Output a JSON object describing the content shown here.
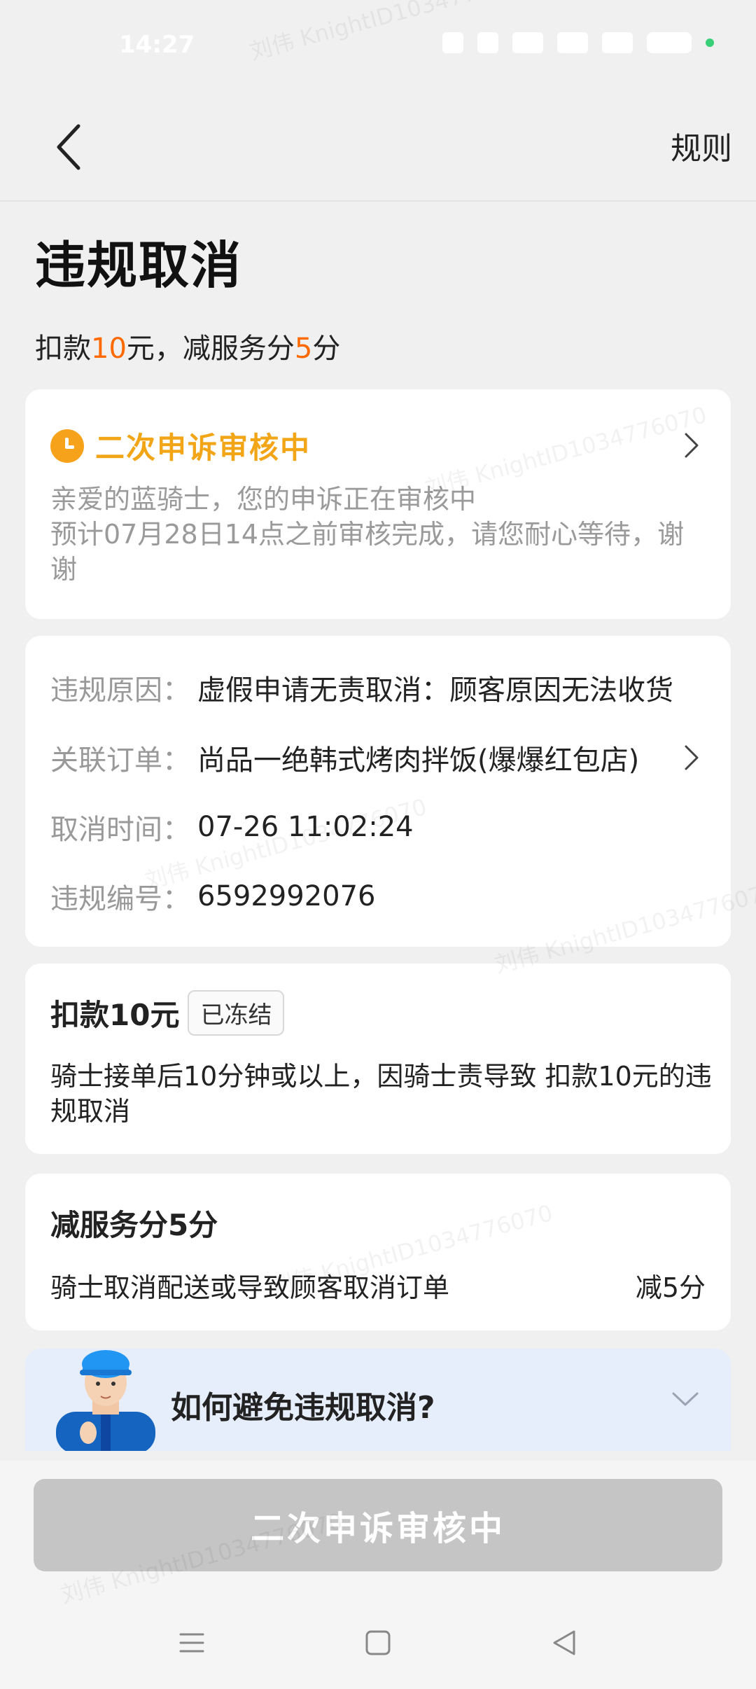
{
  "status_bar": {
    "time": "14:27",
    "icons": [
      "bluetooth-icon",
      "location-icon",
      "wifi-icon",
      "signal-5g-icon",
      "signal-5g-icon",
      "battery-icon"
    ]
  },
  "nav": {
    "back_icon": "chevron-left-icon",
    "rules_label": "规则"
  },
  "header": {
    "title": "违规取消",
    "penalty_prefix": "扣款",
    "penalty_amount": "10",
    "penalty_unit": "元，减服务分",
    "penalty_score": "5",
    "penalty_suffix": "分"
  },
  "status_card": {
    "title": "二次申诉审核中",
    "line1": "亲爱的蓝骑士，您的申诉正在审核中",
    "line2": "预计07月28日14点之前审核完成，请您耐心等待，谢谢",
    "accent_color": "#f2a516"
  },
  "info_card": {
    "rows": [
      {
        "label": "违规原因：",
        "value": "虚假申请无责取消：顾客原因无法收货"
      },
      {
        "label": "关联订单：",
        "value": "尚品一绝韩式烤肉拌饭(爆爆红包店)"
      },
      {
        "label": "取消时间：",
        "value": "07-26 11:02:24"
      },
      {
        "label": "违规编号：",
        "value": "6592992076"
      }
    ]
  },
  "deduct_card": {
    "title": "扣款10元",
    "badge": "已冻结",
    "desc": "骑士接单后10分钟或以上，因骑士责导致 扣款10元的违规取消"
  },
  "score_card": {
    "title": "减服务分5分",
    "rule": "骑士取消配送或导致顾客取消订单",
    "value": "减5分"
  },
  "tips": {
    "text": "如何避免违规取消?"
  },
  "bottom": {
    "button_label": "二次申诉审核中"
  },
  "watermark": "刘伟 KnightID1034776070",
  "colors": {
    "orange": "#ff6a00",
    "button_disabled": "#c5c5c5",
    "tips_bg": "#e7eefb"
  }
}
